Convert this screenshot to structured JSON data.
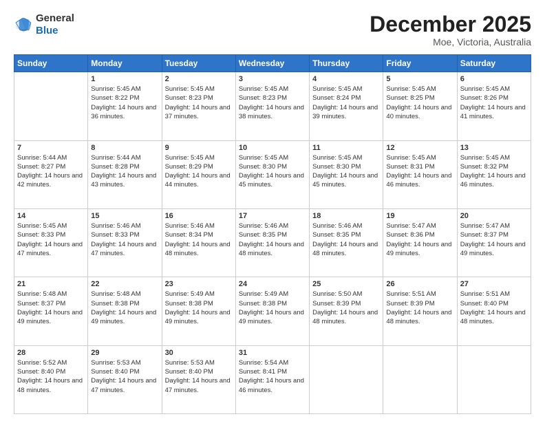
{
  "header": {
    "logo": {
      "line1": "General",
      "line2": "Blue"
    },
    "title": "December 2025",
    "subtitle": "Moe, Victoria, Australia"
  },
  "days_of_week": [
    "Sunday",
    "Monday",
    "Tuesday",
    "Wednesday",
    "Thursday",
    "Friday",
    "Saturday"
  ],
  "weeks": [
    [
      {
        "day": "",
        "sunrise": "",
        "sunset": "",
        "daylight": ""
      },
      {
        "day": "1",
        "sunrise": "5:45 AM",
        "sunset": "8:22 PM",
        "daylight": "14 hours and 36 minutes."
      },
      {
        "day": "2",
        "sunrise": "5:45 AM",
        "sunset": "8:23 PM",
        "daylight": "14 hours and 37 minutes."
      },
      {
        "day": "3",
        "sunrise": "5:45 AM",
        "sunset": "8:23 PM",
        "daylight": "14 hours and 38 minutes."
      },
      {
        "day": "4",
        "sunrise": "5:45 AM",
        "sunset": "8:24 PM",
        "daylight": "14 hours and 39 minutes."
      },
      {
        "day": "5",
        "sunrise": "5:45 AM",
        "sunset": "8:25 PM",
        "daylight": "14 hours and 40 minutes."
      },
      {
        "day": "6",
        "sunrise": "5:45 AM",
        "sunset": "8:26 PM",
        "daylight": "14 hours and 41 minutes."
      }
    ],
    [
      {
        "day": "7",
        "sunrise": "5:44 AM",
        "sunset": "8:27 PM",
        "daylight": "14 hours and 42 minutes."
      },
      {
        "day": "8",
        "sunrise": "5:44 AM",
        "sunset": "8:28 PM",
        "daylight": "14 hours and 43 minutes."
      },
      {
        "day": "9",
        "sunrise": "5:45 AM",
        "sunset": "8:29 PM",
        "daylight": "14 hours and 44 minutes."
      },
      {
        "day": "10",
        "sunrise": "5:45 AM",
        "sunset": "8:30 PM",
        "daylight": "14 hours and 45 minutes."
      },
      {
        "day": "11",
        "sunrise": "5:45 AM",
        "sunset": "8:30 PM",
        "daylight": "14 hours and 45 minutes."
      },
      {
        "day": "12",
        "sunrise": "5:45 AM",
        "sunset": "8:31 PM",
        "daylight": "14 hours and 46 minutes."
      },
      {
        "day": "13",
        "sunrise": "5:45 AM",
        "sunset": "8:32 PM",
        "daylight": "14 hours and 46 minutes."
      }
    ],
    [
      {
        "day": "14",
        "sunrise": "5:45 AM",
        "sunset": "8:33 PM",
        "daylight": "14 hours and 47 minutes."
      },
      {
        "day": "15",
        "sunrise": "5:46 AM",
        "sunset": "8:33 PM",
        "daylight": "14 hours and 47 minutes."
      },
      {
        "day": "16",
        "sunrise": "5:46 AM",
        "sunset": "8:34 PM",
        "daylight": "14 hours and 48 minutes."
      },
      {
        "day": "17",
        "sunrise": "5:46 AM",
        "sunset": "8:35 PM",
        "daylight": "14 hours and 48 minutes."
      },
      {
        "day": "18",
        "sunrise": "5:46 AM",
        "sunset": "8:35 PM",
        "daylight": "14 hours and 48 minutes."
      },
      {
        "day": "19",
        "sunrise": "5:47 AM",
        "sunset": "8:36 PM",
        "daylight": "14 hours and 49 minutes."
      },
      {
        "day": "20",
        "sunrise": "5:47 AM",
        "sunset": "8:37 PM",
        "daylight": "14 hours and 49 minutes."
      }
    ],
    [
      {
        "day": "21",
        "sunrise": "5:48 AM",
        "sunset": "8:37 PM",
        "daylight": "14 hours and 49 minutes."
      },
      {
        "day": "22",
        "sunrise": "5:48 AM",
        "sunset": "8:38 PM",
        "daylight": "14 hours and 49 minutes."
      },
      {
        "day": "23",
        "sunrise": "5:49 AM",
        "sunset": "8:38 PM",
        "daylight": "14 hours and 49 minutes."
      },
      {
        "day": "24",
        "sunrise": "5:49 AM",
        "sunset": "8:38 PM",
        "daylight": "14 hours and 49 minutes."
      },
      {
        "day": "25",
        "sunrise": "5:50 AM",
        "sunset": "8:39 PM",
        "daylight": "14 hours and 48 minutes."
      },
      {
        "day": "26",
        "sunrise": "5:51 AM",
        "sunset": "8:39 PM",
        "daylight": "14 hours and 48 minutes."
      },
      {
        "day": "27",
        "sunrise": "5:51 AM",
        "sunset": "8:40 PM",
        "daylight": "14 hours and 48 minutes."
      }
    ],
    [
      {
        "day": "28",
        "sunrise": "5:52 AM",
        "sunset": "8:40 PM",
        "daylight": "14 hours and 48 minutes."
      },
      {
        "day": "29",
        "sunrise": "5:53 AM",
        "sunset": "8:40 PM",
        "daylight": "14 hours and 47 minutes."
      },
      {
        "day": "30",
        "sunrise": "5:53 AM",
        "sunset": "8:40 PM",
        "daylight": "14 hours and 47 minutes."
      },
      {
        "day": "31",
        "sunrise": "5:54 AM",
        "sunset": "8:41 PM",
        "daylight": "14 hours and 46 minutes."
      },
      {
        "day": "",
        "sunrise": "",
        "sunset": "",
        "daylight": ""
      },
      {
        "day": "",
        "sunrise": "",
        "sunset": "",
        "daylight": ""
      },
      {
        "day": "",
        "sunrise": "",
        "sunset": "",
        "daylight": ""
      }
    ]
  ]
}
